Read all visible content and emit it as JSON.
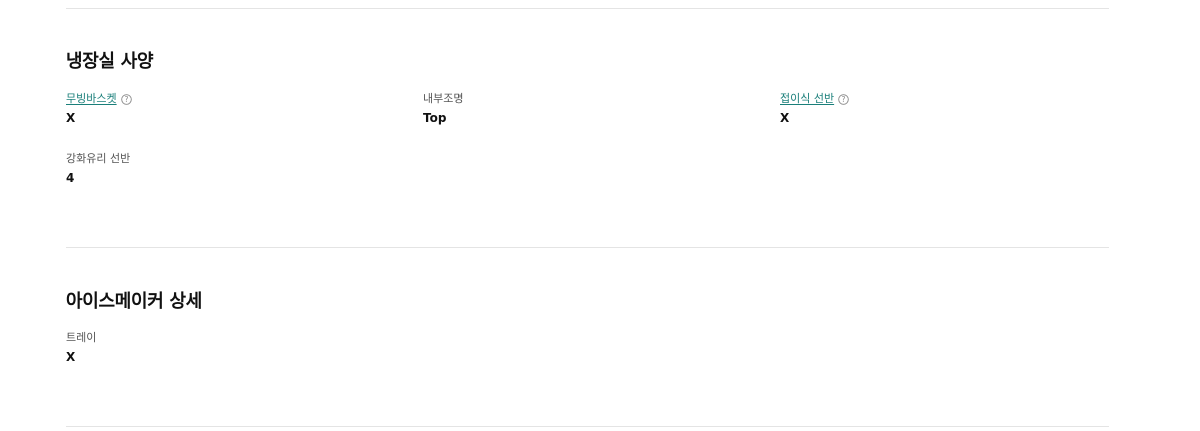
{
  "fridge_section": {
    "title": "냉장실 사양",
    "specs": [
      {
        "label": "무빙바스켓",
        "value": "X"
      },
      {
        "label": "내부조명",
        "value": "Top"
      },
      {
        "label": "접이식 선반",
        "value": "X"
      },
      {
        "label": "강화유리 선반",
        "value": "4"
      }
    ]
  },
  "ice_section": {
    "title": "아이스메이커 상세",
    "specs": [
      {
        "label": "트레이",
        "value": "X"
      }
    ]
  },
  "colors": {
    "link": "#1a7f7a",
    "divider": "#e4e4e4",
    "text": "#111111",
    "label": "#555555"
  },
  "icons": {
    "help": "question-circle-icon"
  }
}
